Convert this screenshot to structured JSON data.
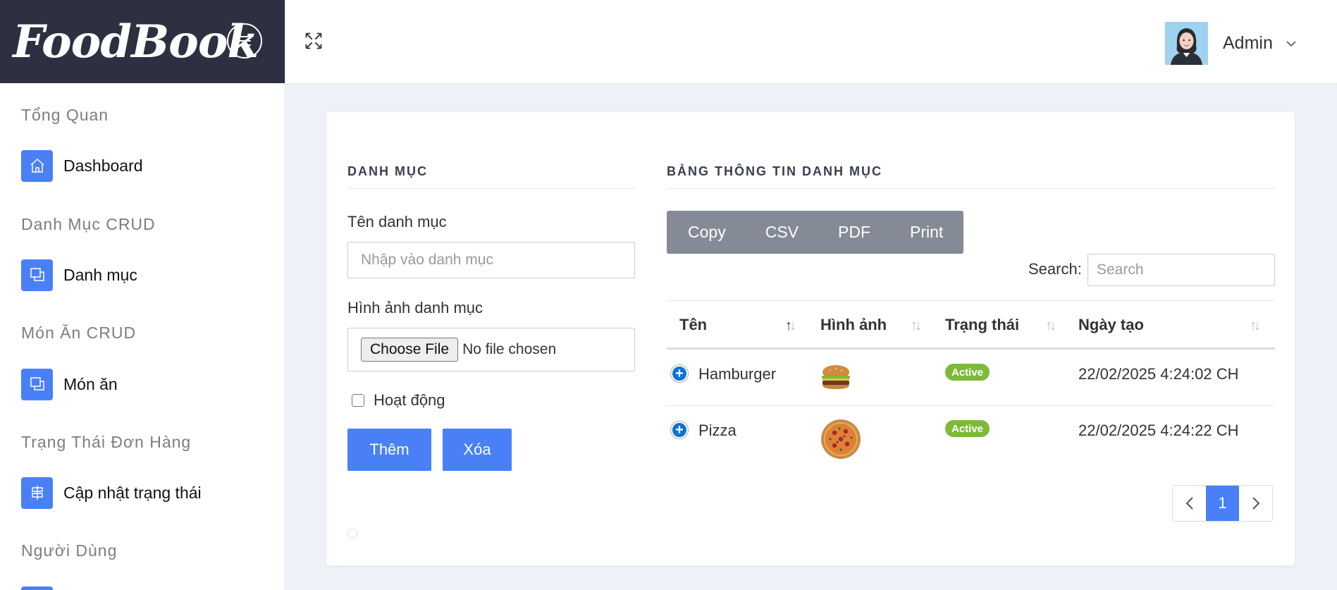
{
  "brand": {
    "name": "FoodBook"
  },
  "sidebar": {
    "sections": [
      {
        "title": "Tổng Quan",
        "items": [
          {
            "label": "Dashboard",
            "icon": "home-icon"
          }
        ]
      },
      {
        "title": "Danh Mục CRUD",
        "items": [
          {
            "label": "Danh mục",
            "icon": "copy-icon"
          }
        ]
      },
      {
        "title": "Món Ăn CRUD",
        "items": [
          {
            "label": "Món ăn",
            "icon": "copy-icon"
          }
        ]
      },
      {
        "title": "Trạng Thái Đơn Hàng",
        "items": [
          {
            "label": "Cập nhật trạng thái",
            "icon": "signpost-icon"
          }
        ]
      },
      {
        "title": "Người Dùng",
        "items": []
      }
    ]
  },
  "topbar": {
    "user_name": "Admin"
  },
  "form": {
    "title": "DANH MỤC",
    "name_label": "Tên danh mục",
    "name_placeholder": "Nhập vào danh mục",
    "image_label": "Hình ảnh danh mục",
    "file_button": "Choose File",
    "file_status": "No file chosen",
    "active_label": "Hoạt động",
    "add_label": "Thêm",
    "delete_label": "Xóa"
  },
  "table": {
    "title": "BẢNG THÔNG TIN DANH MỤC",
    "export_buttons": [
      "Copy",
      "CSV",
      "PDF",
      "Print"
    ],
    "search_label": "Search:",
    "search_placeholder": "Search",
    "columns": [
      "Tên",
      "Hình ảnh",
      "Trạng thái",
      "Ngày tạo"
    ],
    "rows": [
      {
        "name": "Hamburger",
        "image": "hamburger-image",
        "status": "Active",
        "created": "22/02/2025 4:24:02 CH"
      },
      {
        "name": "Pizza",
        "image": "pizza-image",
        "status": "Active",
        "created": "22/02/2025 4:24:22 CH"
      }
    ],
    "pagination": {
      "prev": "‹",
      "current": "1",
      "next": "›"
    }
  },
  "colors": {
    "accent": "#4a80f5",
    "brand_bg": "#2d3040",
    "badge": "#7cba38",
    "export_bg": "#858b96"
  }
}
